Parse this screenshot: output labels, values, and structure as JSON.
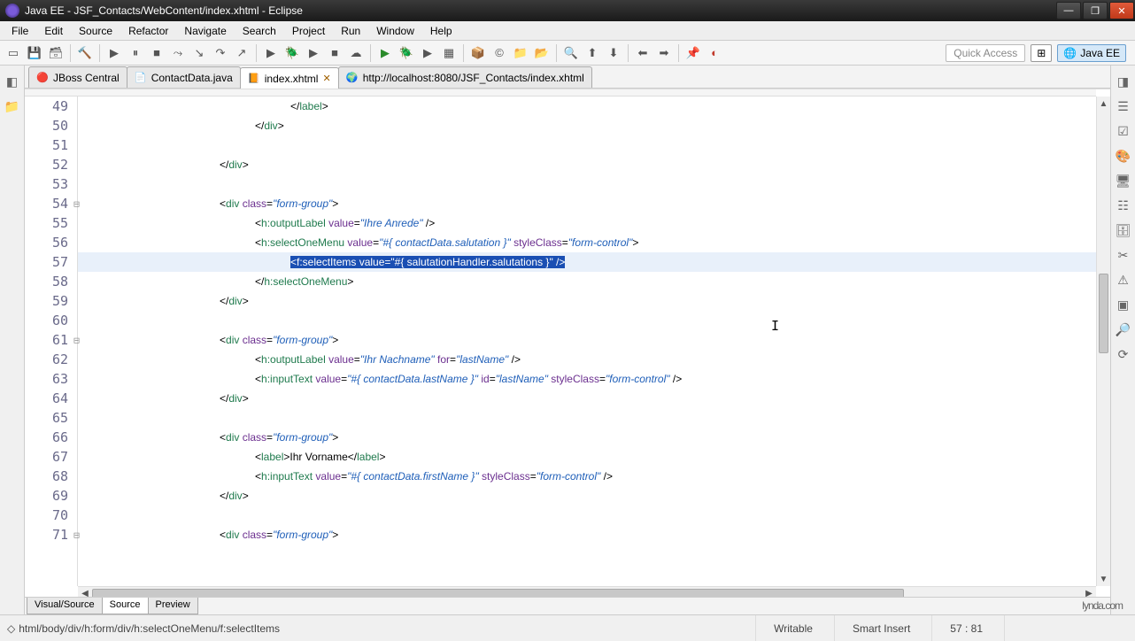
{
  "window": {
    "title": "Java EE - JSF_Contacts/WebContent/index.xhtml - Eclipse"
  },
  "menu": [
    "File",
    "Edit",
    "Source",
    "Refactor",
    "Navigate",
    "Search",
    "Project",
    "Run",
    "Window",
    "Help"
  ],
  "toolbar": {
    "quick_access": "Quick Access",
    "perspective_open": "⊞",
    "perspective_javaee": "Java EE"
  },
  "tabs": [
    {
      "label": "JBoss Central",
      "icon": "🔴",
      "closable": false
    },
    {
      "label": "ContactData.java",
      "icon": "📄",
      "closable": false
    },
    {
      "label": "index.xhtml",
      "icon": "📙",
      "closable": true,
      "active": true
    },
    {
      "label": "http://localhost:8080/JSF_Contacts/index.xhtml",
      "icon": "🌍",
      "closable": false
    }
  ],
  "code": {
    "first_line_no": 49,
    "highlight_index": 8,
    "fold_lines": [
      5,
      12,
      22
    ],
    "marker_line": 8,
    "lines": [
      {
        "indent": 24,
        "html": "<span class='p'>&lt;/</span><span class='el'>label</span><span class='p'>&gt;</span>"
      },
      {
        "indent": 20,
        "html": "<span class='p'>&lt;/</span><span class='el'>div</span><span class='p'>&gt;</span>"
      },
      {
        "indent": 0,
        "html": ""
      },
      {
        "indent": 16,
        "html": "<span class='p'>&lt;/</span><span class='el'>div</span><span class='p'>&gt;</span>"
      },
      {
        "indent": 0,
        "html": ""
      },
      {
        "indent": 16,
        "html": "<span class='p'>&lt;</span><span class='el'>div</span> <span class='an'>class</span><span class='p'>=</span><span class='av'>\"form-group\"</span><span class='p'>&gt;</span>"
      },
      {
        "indent": 20,
        "html": "<span class='p'>&lt;</span><span class='el'>h:outputLabel</span> <span class='an'>value</span><span class='p'>=</span><span class='av'>\"Ihre Anrede\"</span> <span class='p'>/&gt;</span>"
      },
      {
        "indent": 20,
        "html": "<span class='p'>&lt;</span><span class='el'>h:selectOneMenu</span> <span class='an'>value</span><span class='p'>=</span><span class='av'>\"#{ contactData.salutation }\"</span> <span class='an'>styleClass</span><span class='p'>=</span><span class='av'>\"form-control\"</span><span class='p'>&gt;</span>"
      },
      {
        "indent": 24,
        "html": "<span class='sel'>&lt;f:selectItems value=\"#{ salutationHandler.salutations }\" /&gt;</span>"
      },
      {
        "indent": 20,
        "html": "<span class='p'>&lt;/</span><span class='el'>h:selectOneMenu</span><span class='p'>&gt;</span>"
      },
      {
        "indent": 16,
        "html": "<span class='p'>&lt;/</span><span class='el'>div</span><span class='p'>&gt;</span>"
      },
      {
        "indent": 0,
        "html": ""
      },
      {
        "indent": 16,
        "html": "<span class='p'>&lt;</span><span class='el'>div</span> <span class='an'>class</span><span class='p'>=</span><span class='av'>\"form-group\"</span><span class='p'>&gt;</span>"
      },
      {
        "indent": 20,
        "html": "<span class='p'>&lt;</span><span class='el'>h:outputLabel</span> <span class='an'>value</span><span class='p'>=</span><span class='av'>\"Ihr Nachname\"</span> <span class='an'>for</span><span class='p'>=</span><span class='av'>\"lastName\"</span> <span class='p'>/&gt;</span>"
      },
      {
        "indent": 20,
        "html": "<span class='p'>&lt;</span><span class='el'>h:inputText</span> <span class='an'>value</span><span class='p'>=</span><span class='av'>\"#{ contactData.lastName }\"</span> <span class='an'>id</span><span class='p'>=</span><span class='av'>\"lastName\"</span> <span class='an'>styleClass</span><span class='p'>=</span><span class='av'>\"form-control\"</span> <span class='p'>/&gt;</span>"
      },
      {
        "indent": 16,
        "html": "<span class='p'>&lt;/</span><span class='el'>div</span><span class='p'>&gt;</span>"
      },
      {
        "indent": 0,
        "html": ""
      },
      {
        "indent": 16,
        "html": "<span class='p'>&lt;</span><span class='el'>div</span> <span class='an'>class</span><span class='p'>=</span><span class='av'>\"form-group\"</span><span class='p'>&gt;</span>"
      },
      {
        "indent": 20,
        "html": "<span class='p'>&lt;</span><span class='el'>label</span><span class='p'>&gt;</span><span class='txt'>Ihr Vorname</span><span class='p'>&lt;/</span><span class='el'>label</span><span class='p'>&gt;</span>"
      },
      {
        "indent": 20,
        "html": "<span class='p'>&lt;</span><span class='el'>h:inputText</span> <span class='an'>value</span><span class='p'>=</span><span class='av'>\"#{ contactData.firstName }\"</span> <span class='an'>styleClass</span><span class='p'>=</span><span class='av'>\"form-control\"</span> <span class='p'>/&gt;</span>"
      },
      {
        "indent": 16,
        "html": "<span class='p'>&lt;/</span><span class='el'>div</span><span class='p'>&gt;</span>"
      },
      {
        "indent": 0,
        "html": ""
      },
      {
        "indent": 16,
        "html": "<span class='p'>&lt;</span><span class='el'>div</span> <span class='an'>class</span><span class='p'>=</span><span class='av'>\"form-group\"</span><span class='p'>&gt;</span>"
      }
    ]
  },
  "bottom_tabs": [
    "Visual/Source",
    "Source",
    "Preview"
  ],
  "bottom_tabs_active": 1,
  "status": {
    "breadcrumb_icon": "◇",
    "breadcrumb": "html/body/div/h:form/div/h:selectOneMenu/f:selectItems",
    "writable": "Writable",
    "insert": "Smart Insert",
    "pos": "57 : 81"
  },
  "watermark": "lynda.com"
}
